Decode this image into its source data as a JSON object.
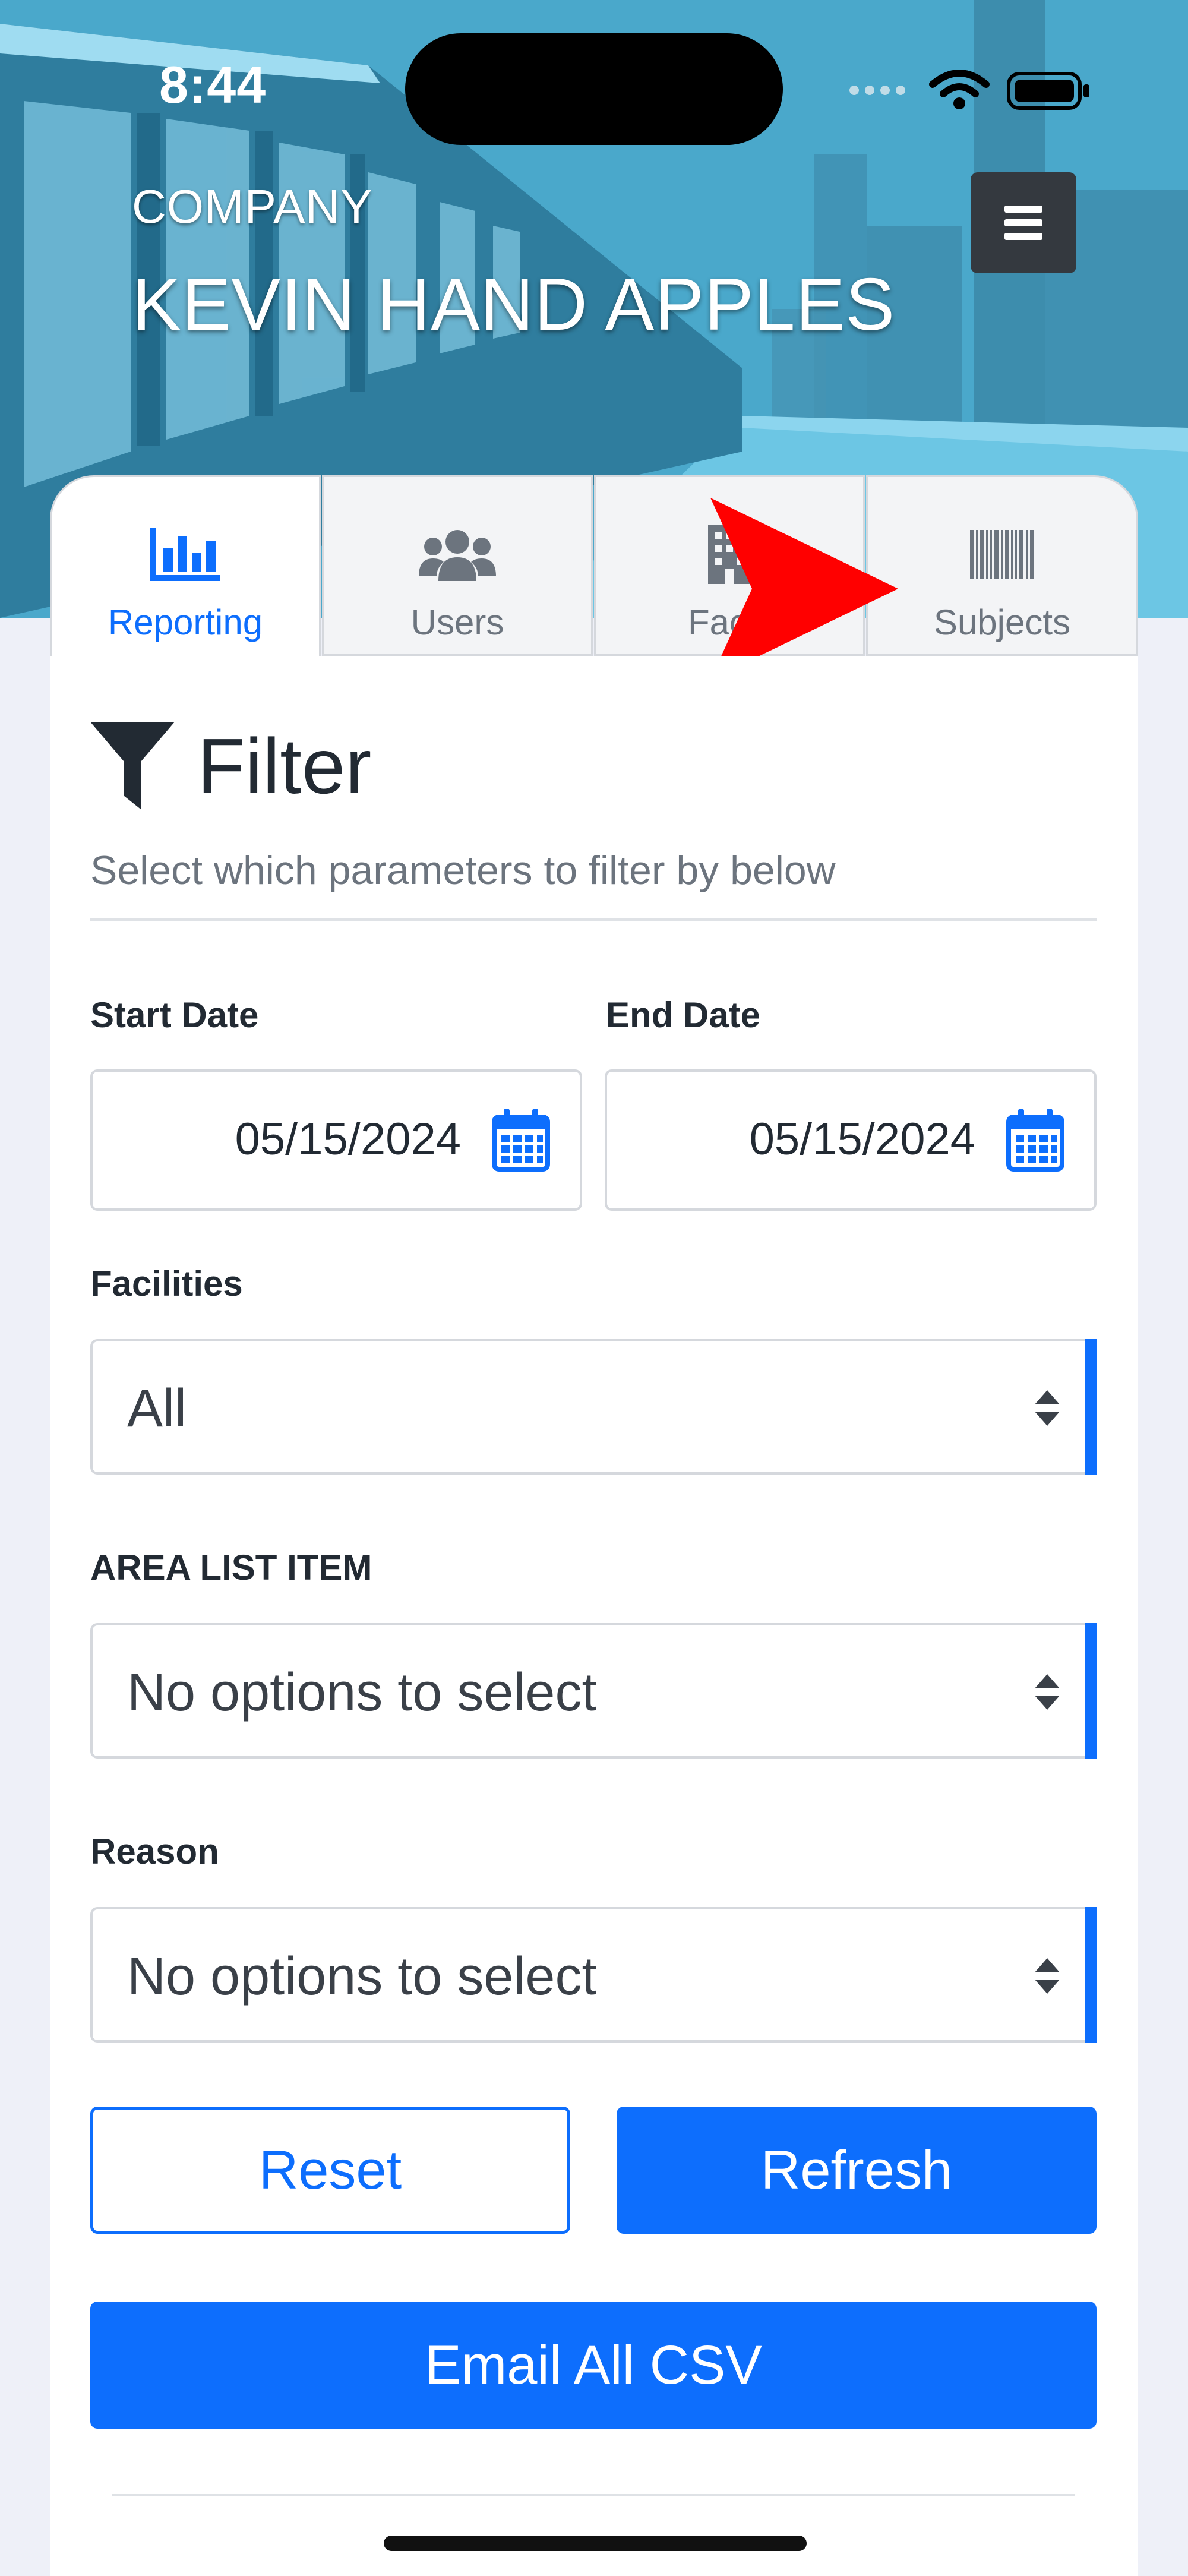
{
  "status_bar": {
    "time": "8:44"
  },
  "header": {
    "company_label": "COMPANY",
    "company_name": "KEVIN HAND APPLES",
    "menu_icon": "hamburger-menu-icon"
  },
  "tabs": [
    {
      "label": "Reporting",
      "icon": "bar-chart-icon",
      "active": true
    },
    {
      "label": "Users",
      "icon": "users-group-icon",
      "active": false
    },
    {
      "label": "Facili",
      "icon": "building-icon",
      "active": false
    },
    {
      "label": "Subjects",
      "icon": "barcode-icon",
      "active": false
    }
  ],
  "filter": {
    "title": "Filter",
    "subtitle": "Select which parameters to filter by below",
    "start_date_label": "Start Date",
    "start_date_value": "05/15/2024",
    "end_date_label": "End Date",
    "end_date_value": "05/15/2024",
    "facilities_label": "Facilities",
    "facilities_value": "All",
    "area_label": "AREA LIST ITEM",
    "area_value": "No options to select",
    "reason_label": "Reason",
    "reason_value": "No options to select"
  },
  "buttons": {
    "reset": "Reset",
    "refresh": "Refresh",
    "email_all_csv": "Email All CSV"
  },
  "colors": {
    "accent": "#0d6efd",
    "annotation_arrow": "#ff0000",
    "menu_button": "#34393f"
  }
}
